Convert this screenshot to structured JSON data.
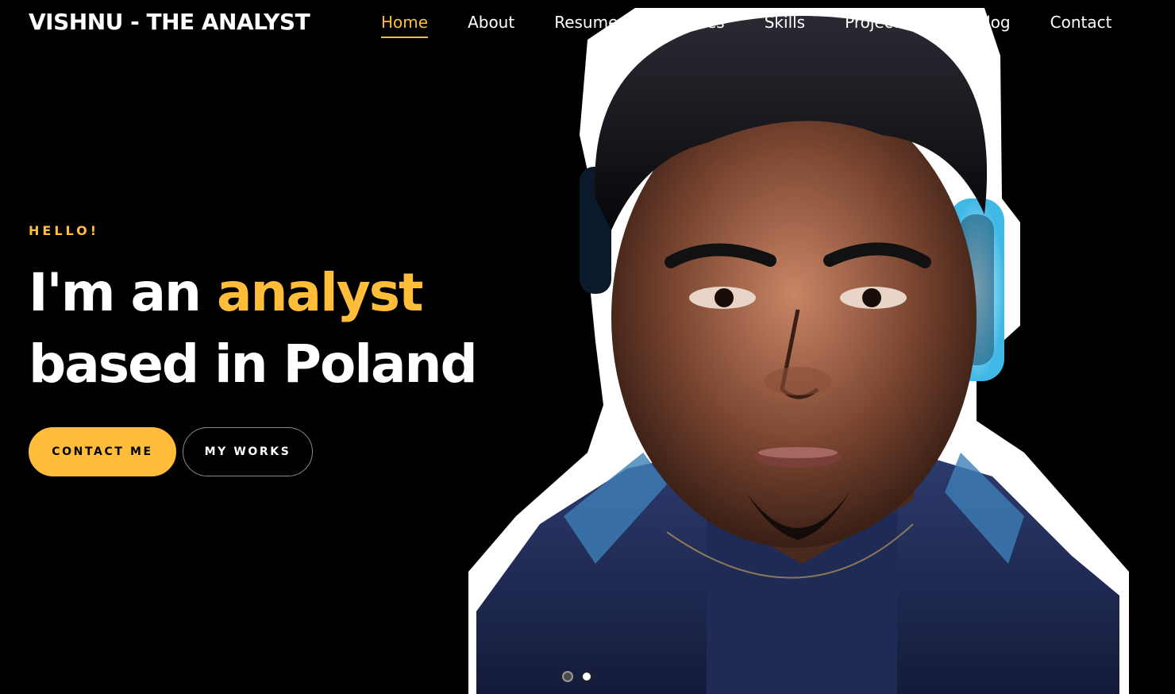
{
  "brand": {
    "name": "VISHNU - THE ANALYST"
  },
  "nav": {
    "items": [
      {
        "label": "Home",
        "active": true
      },
      {
        "label": "About",
        "active": false
      },
      {
        "label": "Resume",
        "active": false
      },
      {
        "label": "Services",
        "active": false
      },
      {
        "label": "Skills",
        "active": false
      },
      {
        "label": "Projects",
        "active": false
      },
      {
        "label": "My Blog",
        "active": false
      },
      {
        "label": "Contact",
        "active": false
      }
    ]
  },
  "hero": {
    "greeting": "HELLO!",
    "headline_part1": "I'm an ",
    "headline_accent": "analyst",
    "headline_part2": "based in Poland",
    "primary_button": "CONTACT ME",
    "secondary_button": "MY WORKS"
  },
  "slider": {
    "slide_count": 2,
    "active_slide": 2
  },
  "colors": {
    "background": "#000000",
    "accent": "#ffbd39",
    "text": "#ffffff"
  },
  "images": {
    "hero_portrait": "portrait of a man with headphones and dark jacket"
  }
}
